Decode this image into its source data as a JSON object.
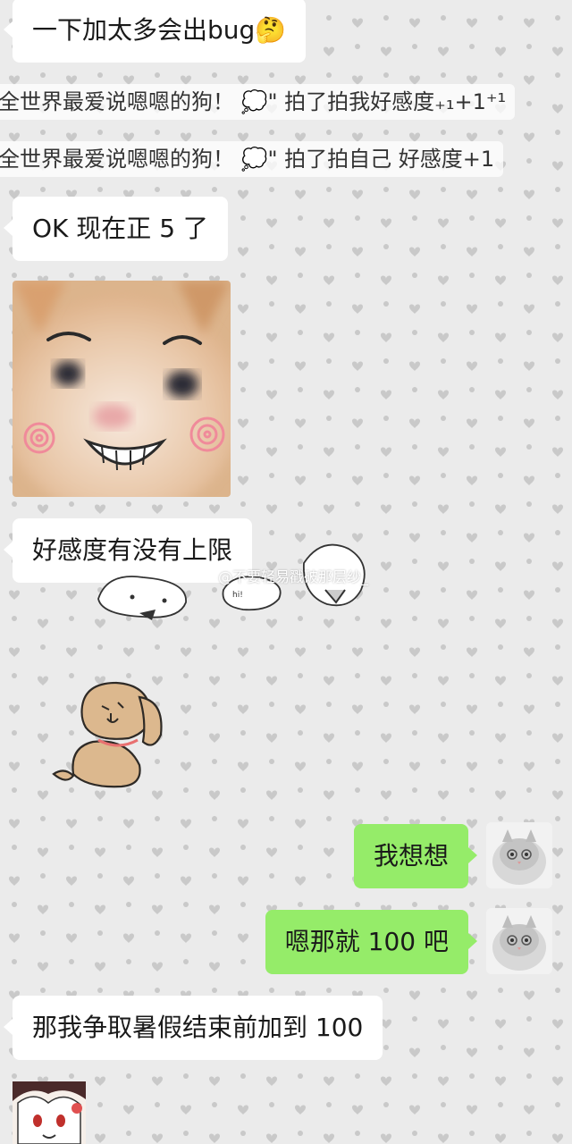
{
  "messages": [
    {
      "text": "一下加太多会出bug🤔"
    },
    {
      "text": "OK 现在正 5 了"
    },
    {
      "text": "好感度有没有上限"
    },
    {
      "text": "我想想"
    },
    {
      "text": "嗯那就 100 吧"
    },
    {
      "text": "那我争取暑假结束前加到 100"
    }
  ],
  "system_notices": [
    {
      "text": "全世界最爱说嗯嗯的狗！ 💭\" 拍了拍我好感度₊₁+1⁺¹"
    },
    {
      "text": "全世界最爱说嗯嗯的狗！ 💭\" 拍了拍自己  好感度+1"
    }
  ],
  "watermark": "@不要轻易戳破那层纱_",
  "colors": {
    "bubble_incoming": "#ffffff",
    "bubble_outgoing": "#95ec69",
    "background": "#ebebeb",
    "heart_pattern": "#c9c9c9"
  }
}
